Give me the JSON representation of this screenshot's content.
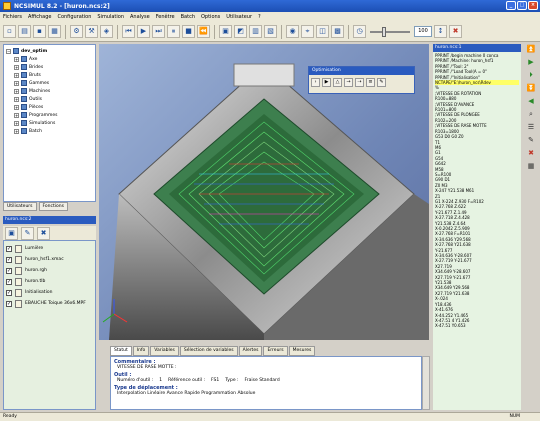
{
  "window": {
    "title": "NCSIMUL 8.2 - [huron.ncs:2]"
  },
  "menu": [
    "Fichiers",
    "Affichage",
    "Configuration",
    "Simulation",
    "Analyse",
    "Fenêtre",
    "Batch",
    "Options",
    "Utilisateur",
    "?"
  ],
  "toolbar": {
    "zoom_value": "100"
  },
  "tree": {
    "root": "dev_optim",
    "items": [
      "Axe",
      "Brides",
      "Bruts",
      "Gammes",
      "Machines",
      "Outils",
      "Pièces",
      "Programmes",
      "Simulations",
      "Batch"
    ]
  },
  "left_tabs": [
    "Utilisateurs",
    "Fonctions"
  ],
  "session": {
    "title": "huron.ncs:2",
    "files": [
      "Lumière",
      "huron_hsf1.xmac",
      "huron.rgh",
      "huron.tlb",
      "Initialisation",
      "EBAUCHE Toique 36x6.MPF"
    ]
  },
  "optimisation": {
    "title": "Optimisation"
  },
  "info_tabs": [
    "Statut",
    "Info",
    "Variables",
    "Sélection de variables",
    "Alertes",
    "Erreurs",
    "Mesures"
  ],
  "info": {
    "commentaire_label": "Commentaire :",
    "commentaire_value": "VITESSE DE RASE MOTTE :",
    "outil_label": "Outil :",
    "numero_label": "Numéro d'outil :",
    "numero_value": "1",
    "ref_label": "Référence outil :",
    "ref_value": "FS1",
    "type_label": "Type :",
    "type_value": "Fraise Standard",
    "deplacement_label": "Type de déplacement :",
    "deplacement_value": "Interpolation     Linéaire Avance     Rapide     Programmation     Absolue"
  },
  "nc_panel": {
    "title": "huron.ncs:1",
    "lines": [
      "PPRINT /begin machine 0 conca",
      "PPRINT /Machine: huron_hsf1",
      "PPRINT /\"Tool: 2\"",
      "PPRINT /\"Load Tool(A = 0\"",
      "PPRINT /\"Initialisation\"",
      "NCTAPE/\"E:\\huron_ncs\\Rdev",
      "%",
      ";VITESSE DE ROTATION",
      "R100=880",
      ";VITESSE D'AVANCE",
      "R101=800",
      ";VITESSE DE PLONGEE",
      "R102=200",
      ";VITESSE DE RASE MOTTE",
      "R103=1800",
      "G53 D0 G0 Z0",
      "T1",
      "M6",
      "G1",
      "G54",
      "G642",
      "M58",
      "S=R100",
      "G90 D1",
      "Z0 M3",
      "X-247 Y21.538 M61",
      "Z1",
      "G1 X-224 Z.930 F=R102",
      "X-27.768 Z.622",
      "Y-21.677 Z.1.49",
      "X-27.718 Z.4.428",
      "Y21.538 Z.4.64",
      "X-0.2042 Z.5.909",
      "X-27.768 F=R101",
      "X-34.636 Y29.568",
      "X-27.768 Y21.638",
      "Y-21.677",
      "X-34.636 Y-28.607",
      "X-27.719 Y-21.677",
      "X27.719",
      "X34.649 Y-28.607",
      "X27.719 Y-21.677",
      "Y21.538",
      "X34.649 Y29.568",
      "X27.719 Y21.638",
      "X-.024",
      "Y18.436",
      "X-41.676",
      "X-44.252 Y1.465",
      "X-47.51 4 Y1.426",
      "X-47.51 Y0.653"
    ]
  },
  "status": {
    "left": "Ready",
    "right": "NUM"
  },
  "colors": {
    "title_blue": "#1c4fb4",
    "panel_green": "#e6f3e2",
    "highlight": "#ffff66"
  }
}
